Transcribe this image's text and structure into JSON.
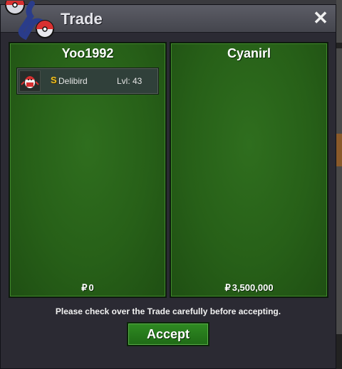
{
  "window": {
    "title": "Trade",
    "close_label": "✕"
  },
  "panels": [
    {
      "name": "Yoo1992",
      "money": "0",
      "items": [
        {
          "badge": "S",
          "name": "Delibird",
          "level": "Lvl: 43"
        }
      ]
    },
    {
      "name": "Cyanirl",
      "money": "3,500,000",
      "items": []
    }
  ],
  "currency_symbol": "₽",
  "notice": "Please check over the Trade carefully before accepting.",
  "accept_label": "Accept",
  "colors": {
    "panel_green": "#276018",
    "accept_green": "#2f8a22",
    "badge_gold": "#f0c020"
  }
}
